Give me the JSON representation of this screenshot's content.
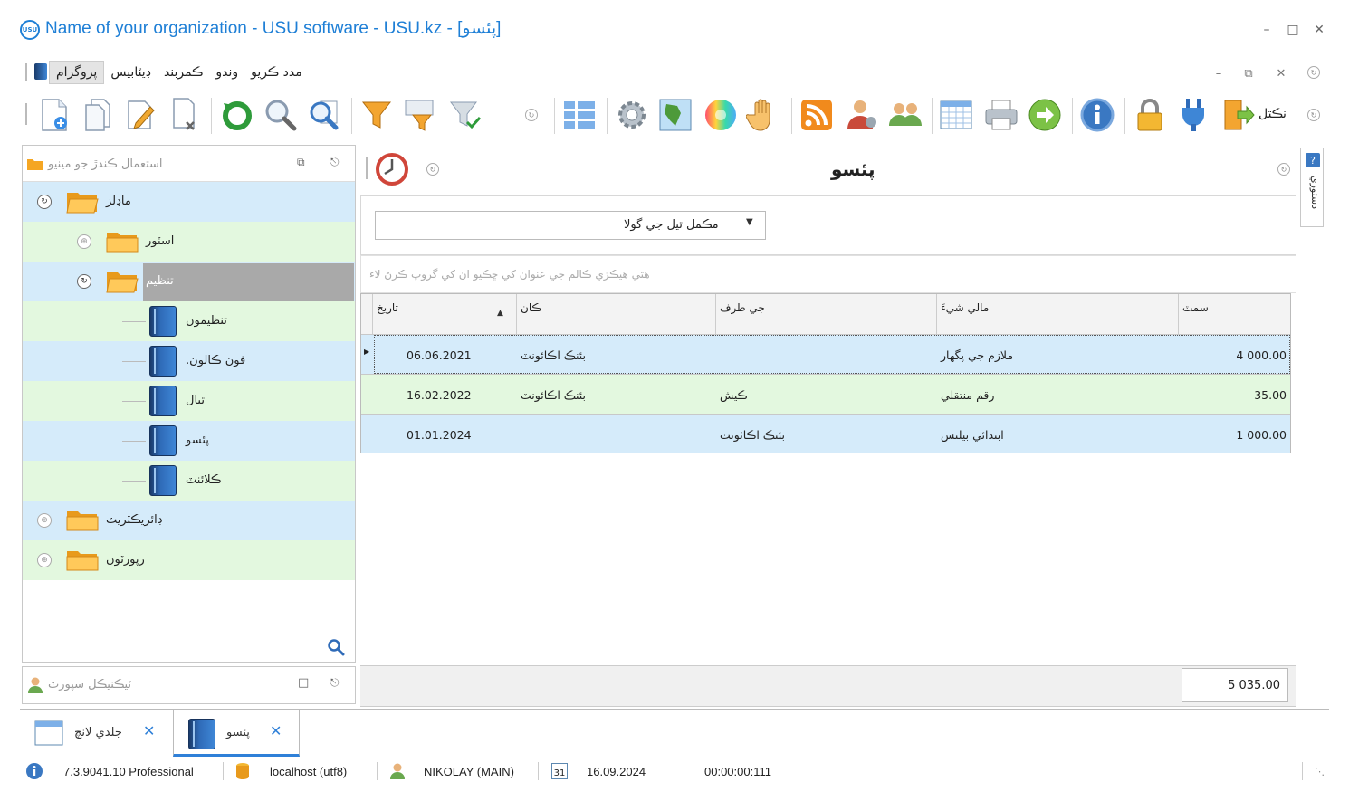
{
  "window": {
    "title": "Name of your organization - USU software - USU.kz - [پئسو]",
    "logo_text": "USU"
  },
  "menu": {
    "items": [
      "پروگرام",
      "ڊيٽابيس",
      "ڪمربند",
      "ونڊو",
      "مدد ڪريو"
    ]
  },
  "toolbar": {
    "exit_label": "نڪتل"
  },
  "nav": {
    "header": "استعمال ڪندڙ جو مينيو",
    "items": {
      "modules": "ماڊلز",
      "store": "اسٽور",
      "organization": "تنظيم",
      "organizations": "تنظيمون",
      "phone_calls": ".فون ڪالون",
      "balance": "تيال",
      "money": "پئسو",
      "clients": "ڪلائنٽ",
      "directories": "ڊائريڪٽريٽ",
      "reports": "رپورٽون"
    }
  },
  "support": {
    "title": "ٽيڪنيڪل سپورٽ"
  },
  "content": {
    "title": "پئسو",
    "dropdown_value": "مڪمل تيل جي گولا",
    "group_hint": "هتي ھيڪڙي ڪالم جي عنوان کي ڇڪيو ان کي گروپ ڪرڻ لاء",
    "grid": {
      "columns": [
        "تاريخ",
        "ڪان",
        "جي طرف",
        "مالي شيءَ",
        "سمٽ"
      ],
      "rows": [
        {
          "date": "06.06.2021",
          "from": "بئنڪ اڪائونٽ",
          "to": "",
          "item": "ملازم جي پگھار",
          "sum": "4 000.00"
        },
        {
          "date": "16.02.2022",
          "from": "بئنڪ اڪائونٽ",
          "to": "ڪيش",
          "item": "رقم منتقلي",
          "sum": "35.00"
        },
        {
          "date": "01.01.2024",
          "from": "",
          "to": "بئنڪ اڪائونٽ",
          "item": "ابتدائي بيلنس",
          "sum": "1 000.00"
        }
      ]
    },
    "total": "5 035.00"
  },
  "side_strip": {
    "label": "دستوري"
  },
  "tabs": [
    {
      "label": "جلدي لانچ"
    },
    {
      "label": "پئسو"
    }
  ],
  "statusbar": {
    "version": "7.3.9041.10 Professional",
    "db": "localhost (utf8)",
    "user": "NIKOLAY (MAIN)",
    "calendar_day": "31",
    "date": "16.09.2024",
    "timer": "00:00:00:111"
  },
  "colors": {
    "accent": "#1e7fd6",
    "row_blue": "#d5ebfa",
    "row_green": "#e3f8df",
    "selected_grey": "#a9a9a9"
  }
}
